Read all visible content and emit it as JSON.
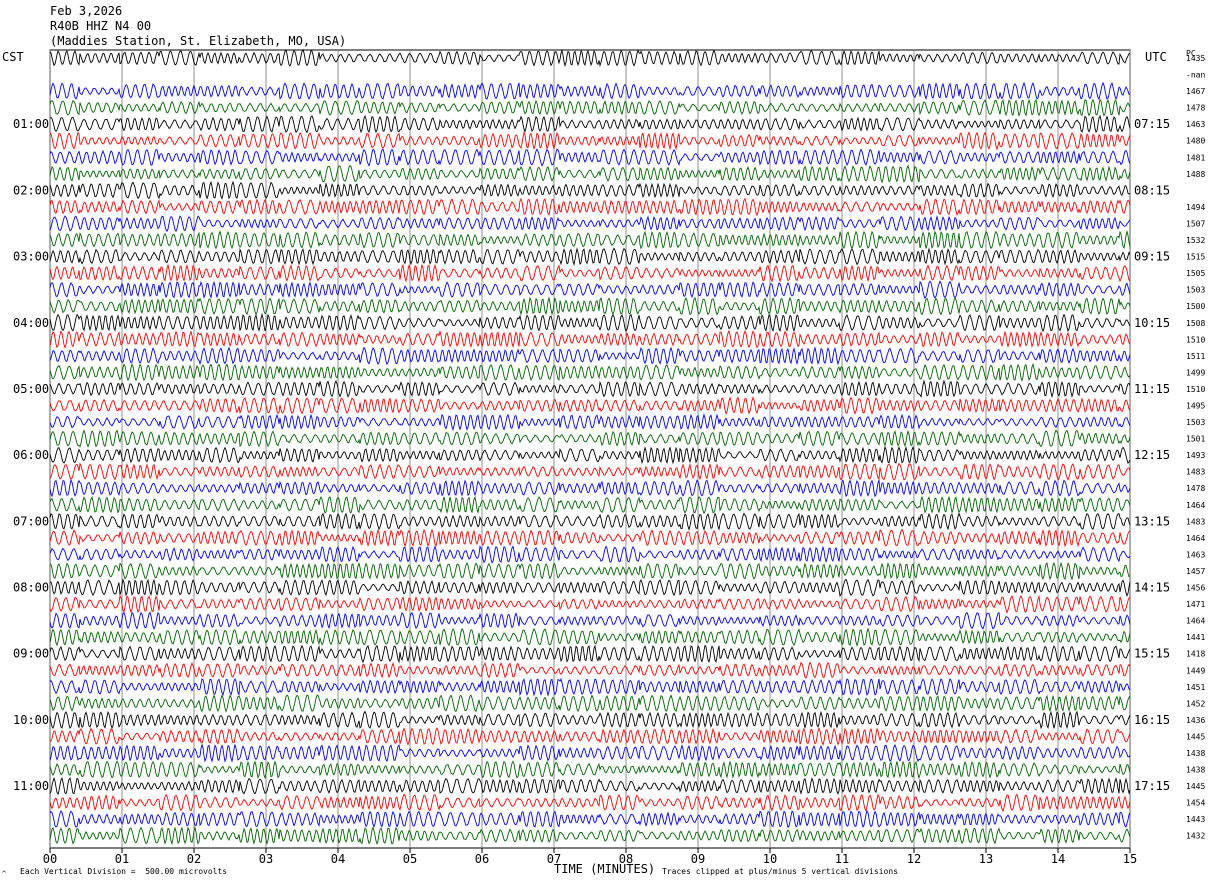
{
  "header": {
    "date": "Feb 3,2026",
    "station_code": "R40B HHZ N4 00",
    "station_name": "(Maddies Station, St. Elizabeth, MO, USA)"
  },
  "labels": {
    "left_timezone": "CST",
    "right_timezone": "UTC",
    "right_column": "PC",
    "scale_note": "Each Vertical Division =  500.00 microvolts",
    "clip_note": "Traces clipped at plus/minus 5 vertical divisions",
    "corner_mark": "^"
  },
  "chart_data": {
    "type": "line",
    "title": "Feb 3,2026 R40B HHZ N4 00 (Maddies Station, St. Elizabeth, MO, USA)",
    "xlabel": "TIME (MINUTES)",
    "ylabel": "",
    "xlim": [
      0,
      15
    ],
    "x_ticks": [
      "00",
      "01",
      "02",
      "03",
      "04",
      "05",
      "06",
      "07",
      "08",
      "09",
      "10",
      "11",
      "12",
      "13",
      "14",
      "15"
    ],
    "left_hour_labels": [
      "01:00",
      "02:00",
      "03:00",
      "04:00",
      "05:00",
      "06:00",
      "07:00",
      "08:00",
      "09:00",
      "10:00",
      "11:00"
    ],
    "right_hour_labels": [
      "07:15",
      "08:15",
      "09:15",
      "10:15",
      "11:15",
      "12:15",
      "13:15",
      "14:15",
      "15:15",
      "16:15",
      "17:15"
    ],
    "trace_colors": [
      "#000000",
      "#ff0000",
      "#0000ff",
      "#006400"
    ],
    "trace_values": [
      "1435",
      "-nan",
      "1467",
      "1478",
      "1463",
      "1480",
      "1481",
      "1488",
      "",
      "1494",
      "1507",
      "1532",
      "1515",
      "1505",
      "1503",
      "1500",
      "1508",
      "1510",
      "1511",
      "1499",
      "1510",
      "1495",
      "1503",
      "1501",
      "1493",
      "1483",
      "1478",
      "1464",
      "1483",
      "1464",
      "1463",
      "1457",
      "1456",
      "1471",
      "1464",
      "1441",
      "1418",
      "1449",
      "1451",
      "1452",
      "1436",
      "1445",
      "1438",
      "1438",
      "1445",
      "1454",
      "1443",
      "1432"
    ],
    "grid": "vertical lines at each minute"
  }
}
